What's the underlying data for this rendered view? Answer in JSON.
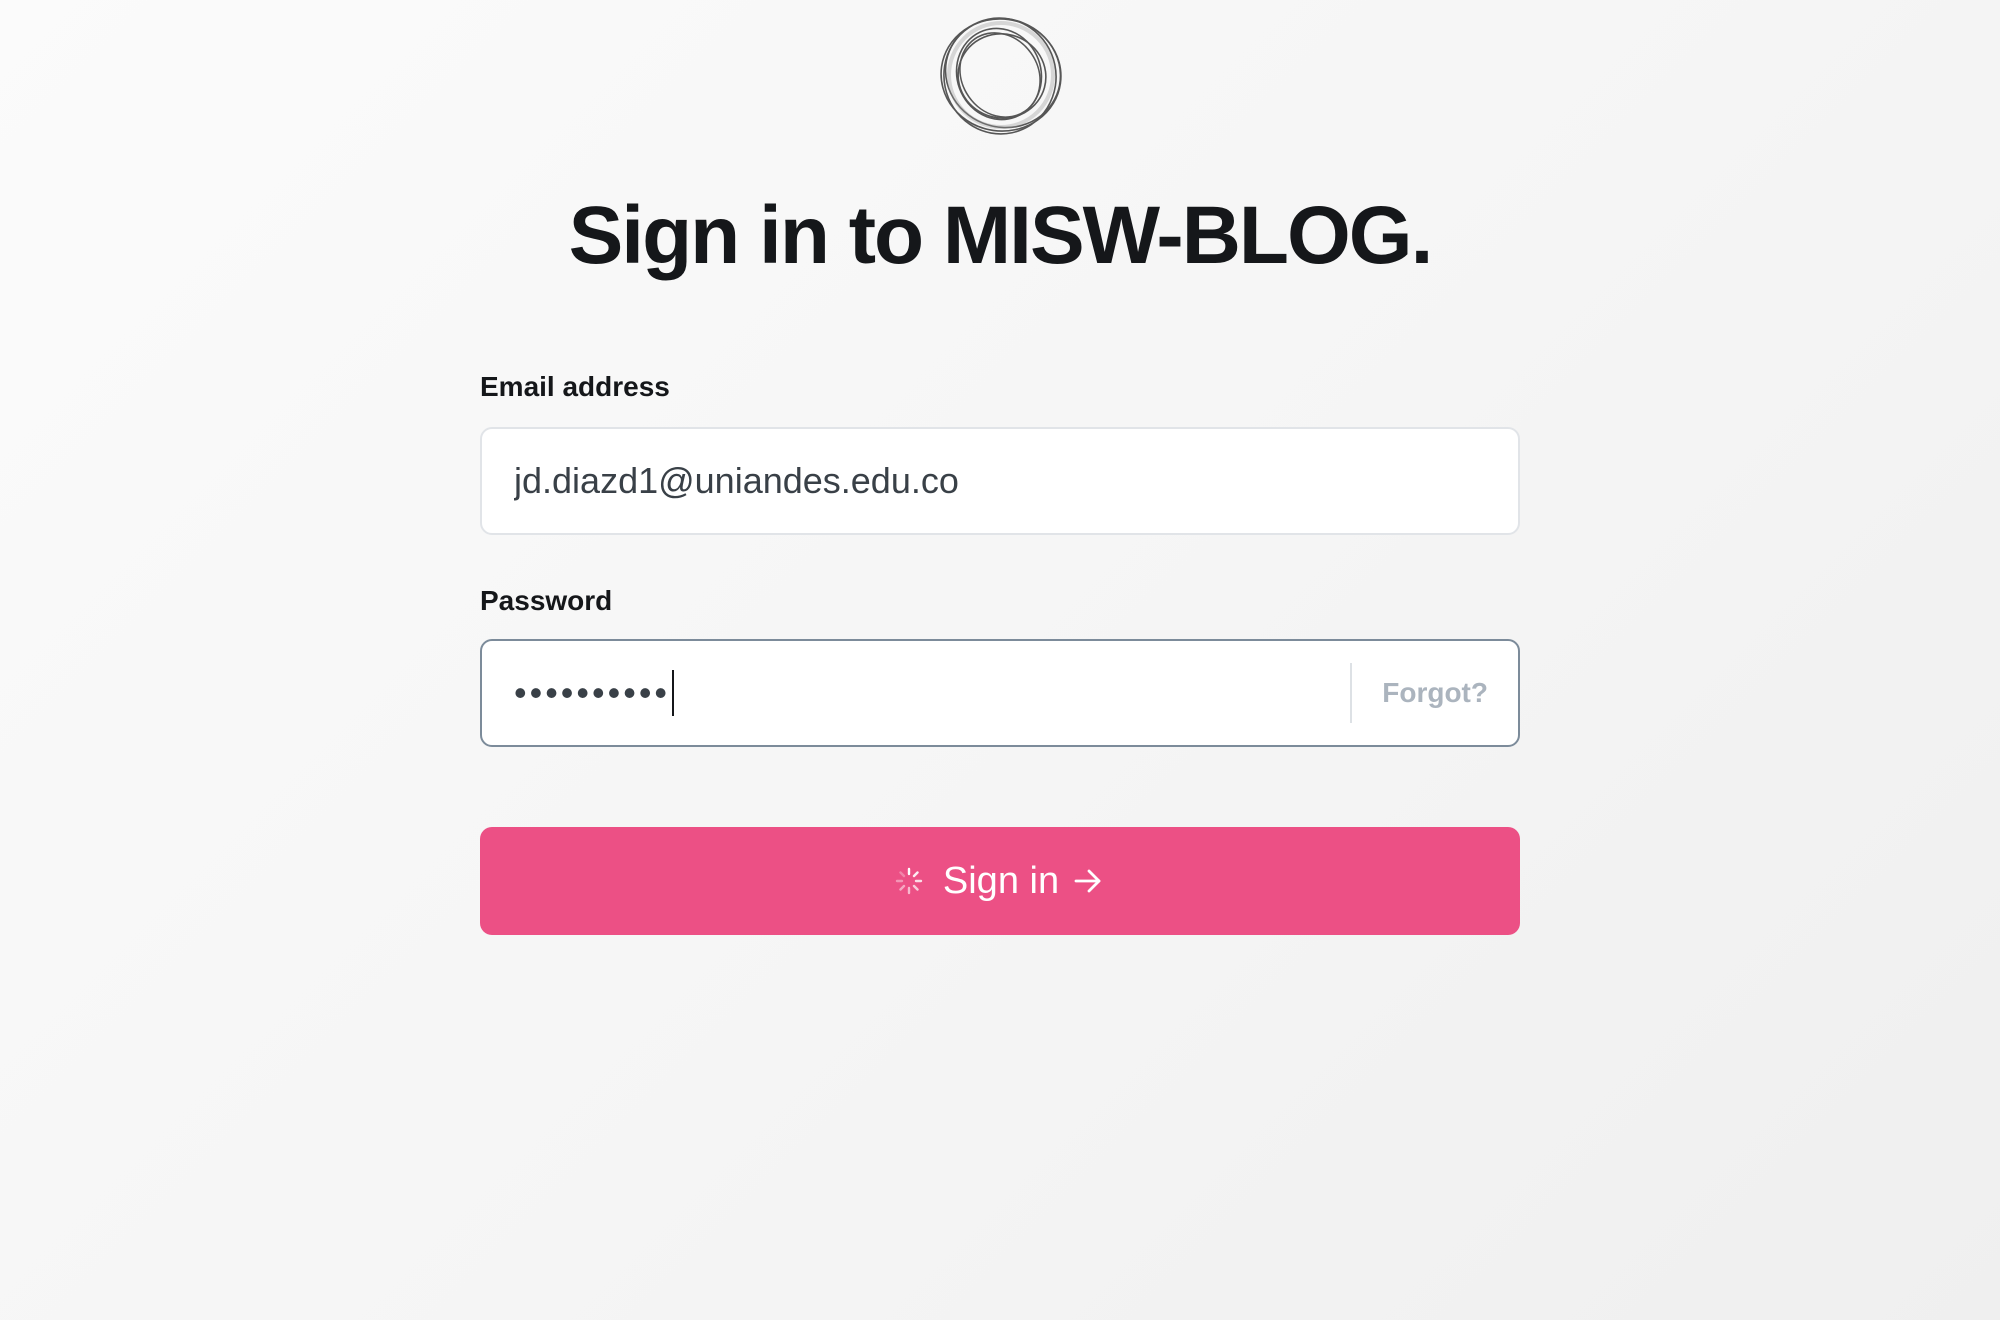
{
  "app": {
    "title": "Sign in to MISW-BLOG."
  },
  "logo": {
    "icon": "ring-logo-icon"
  },
  "form": {
    "email": {
      "label": "Email address",
      "value": "jd.diazd1@uniandes.edu.co",
      "type": "email"
    },
    "password": {
      "label": "Password",
      "masked_value": "••••••••••",
      "forgot_label": "Forgot?"
    },
    "submit": {
      "label": "Sign in",
      "state": "loading",
      "icons": [
        "spinner-icon",
        "arrow-right-icon"
      ]
    }
  },
  "colors": {
    "accent": "#ec5085",
    "text": "#15171a",
    "muted": "#abb4be",
    "input_border": "#e1e4e8",
    "input_border_focus": "#7c8b9a"
  }
}
